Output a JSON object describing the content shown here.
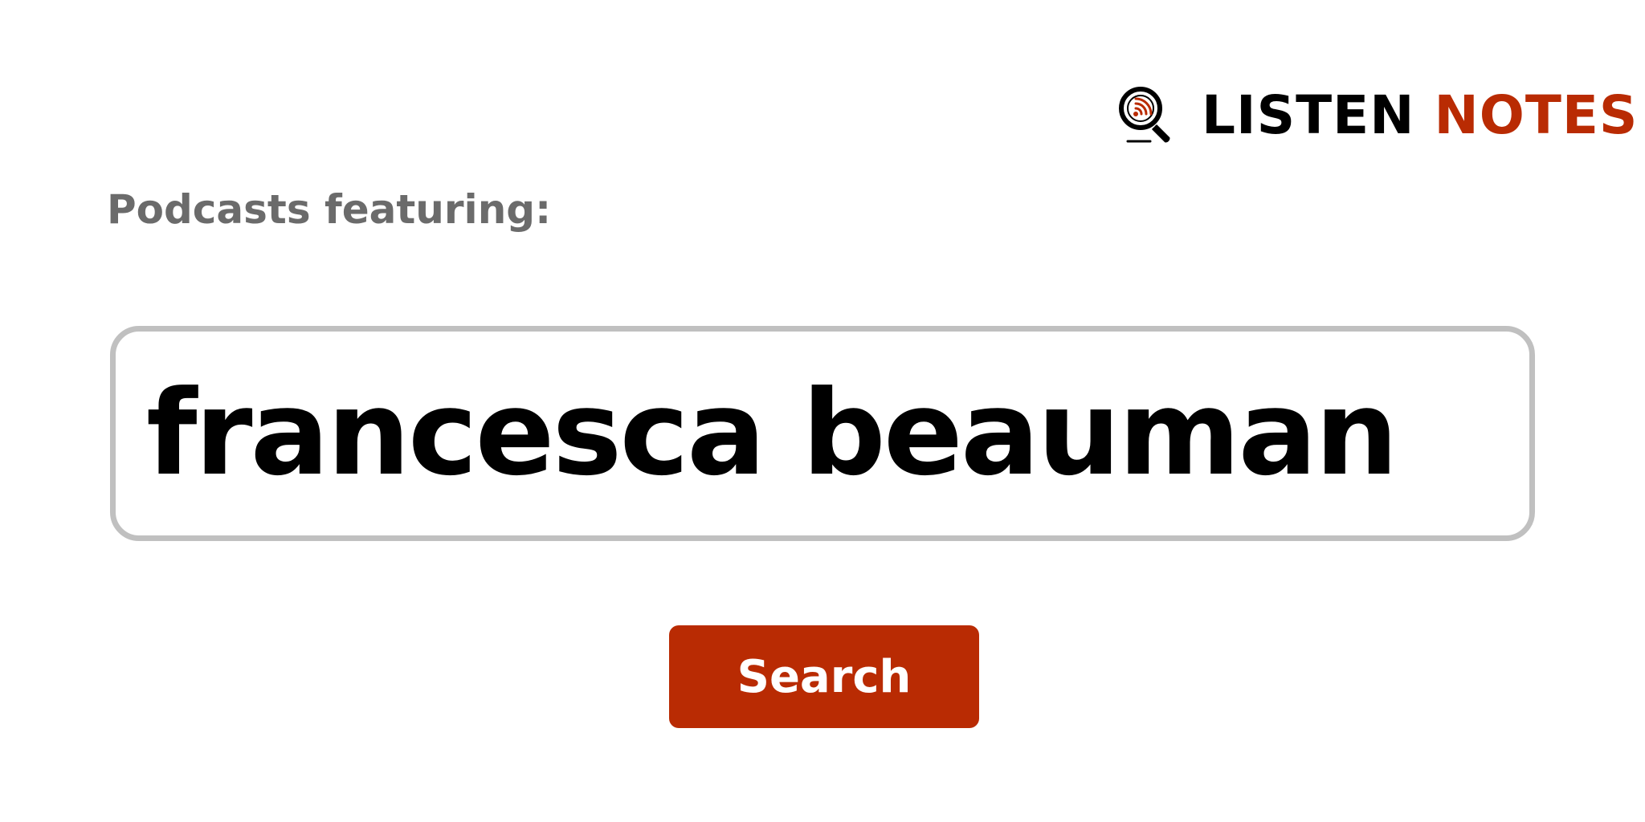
{
  "brand": {
    "word1": "LISTEN",
    "word2": "NOTES",
    "icon": "magnifier-podcast-icon",
    "color_primary": "#000000",
    "color_accent": "#b92b03"
  },
  "heading": {
    "label": "Podcasts featuring:"
  },
  "search": {
    "value": "francesca beauman",
    "border_color": "#c0c0c0"
  },
  "button": {
    "label": "Search",
    "color": "#b92b03"
  }
}
